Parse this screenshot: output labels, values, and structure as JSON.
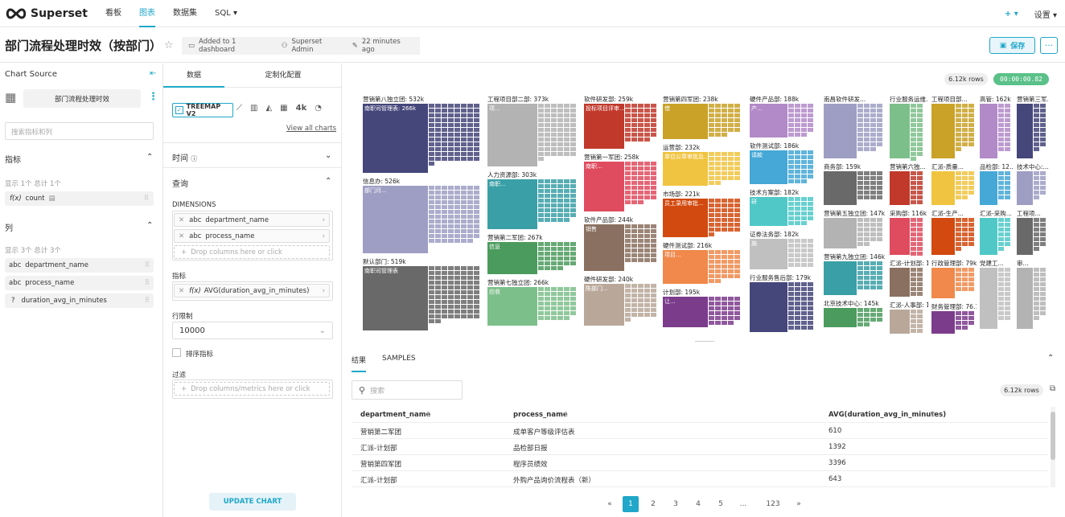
{
  "nav": {
    "brand": "Superset",
    "links": [
      "看板",
      "图表",
      "数据集",
      "SQL ▾"
    ],
    "plus": "+ ▾",
    "settings": "设置 ▾"
  },
  "header": {
    "title": "部门流程处理时效（按部门）",
    "dashboards": "Added to 1 dashboard",
    "owner": "Superset Admin",
    "modified": "22 minutes ago",
    "save": "保存"
  },
  "source": {
    "label": "Chart Source",
    "dataset": "部门流程处理时效",
    "search_placeholder": "搜索指标和列",
    "metrics_title": "指标",
    "metrics_count": "显示 1个 总计 1个",
    "metrics": [
      "count"
    ],
    "columns_title": "列",
    "columns_count": "显示 3个 总计 3个",
    "columns": [
      {
        "type": "abc",
        "name": "department_name"
      },
      {
        "type": "abc",
        "name": "process_name"
      },
      {
        "type": "?",
        "name": "duration_avg_in_minutes"
      }
    ]
  },
  "config": {
    "tab_data": "数据",
    "tab_custom": "定制化配置",
    "viz_name": "TREEMAP V2",
    "viz_4k": "4k",
    "view_all": "View all charts",
    "time": "时间",
    "query": "查询",
    "dimensions_label": "DIMENSIONS",
    "dimensions": [
      "department_name",
      "process_name"
    ],
    "dim_drop": "Drop columns here or click",
    "metrics_label": "指标",
    "metric": "AVG(duration_avg_in_minutes)",
    "row_limit_label": "行限制",
    "row_limit": "10000",
    "sort_label": "排序指标",
    "filter_label": "过滤",
    "filter_drop": "Drop columns/metrics here or click",
    "update": "UPDATE CHART"
  },
  "chart": {
    "rows_badge": "6.12k rows",
    "timer": "00:00:00.82",
    "colors": [
      "#45467a",
      "#9e9ec4",
      "#696969",
      "#b3b3b3",
      "#3a9fa6",
      "#4c9b5e",
      "#7dbf8a",
      "#c0392b",
      "#e04c5f",
      "#8a7060",
      "#b9a89a",
      "#c9a227",
      "#f0c440",
      "#d24a0f",
      "#f0894b",
      "#7c3c8c",
      "#b28ac8",
      "#45a8d6",
      "#50c8c8",
      "#c0c0c0"
    ]
  },
  "chart_data": {
    "type": "treemap",
    "groups": [
      {
        "name": "营销第八独立团: 532k",
        "value": 532
      },
      {
        "name": "工程项目部二部: 373k",
        "value": 373
      },
      {
        "name": "软件研发部: 259k",
        "value": 259
      },
      {
        "name": "营销第四军团: 238k",
        "value": 238
      },
      {
        "name": "硬件产品部: 188k",
        "value": 188
      },
      {
        "name": "南昌软件研发...",
        "value": 170
      },
      {
        "name": "行业服务运维...",
        "value": 170
      },
      {
        "name": "工程项目部...",
        "value": 165
      },
      {
        "name": "高管: 162k",
        "value": 162
      },
      {
        "name": "营销第三军...",
        "value": 160
      },
      {
        "name": "信息办: 526k",
        "value": 526
      },
      {
        "name": "人力资源部: 303k",
        "value": 303
      },
      {
        "name": "营销第一军团: 258k",
        "value": 258
      },
      {
        "name": "运营部: 232k",
        "value": 232
      },
      {
        "name": "软件测试部: 186k",
        "value": 186
      },
      {
        "name": "商务部: 159k",
        "value": 159
      },
      {
        "name": "营销第六独...",
        "value": 155
      },
      {
        "name": "汇派-质量...",
        "value": 150
      },
      {
        "name": "品检部: 12...",
        "value": 125
      },
      {
        "name": "技术中心:...",
        "value": 120
      },
      {
        "name": "市场部: 221k",
        "value": 221
      },
      {
        "name": "技术方案部: 182k",
        "value": 182
      },
      {
        "name": "营销第五独立团: 147k",
        "value": 147
      },
      {
        "name": "软件产品部: 244k",
        "value": 244
      },
      {
        "name": "营销第二军团: 267k",
        "value": 267
      },
      {
        "name": "采购部: 116k",
        "value": 116
      },
      {
        "name": "汇派-生产...",
        "value": 110
      },
      {
        "name": "汇派-采购...",
        "value": 108
      },
      {
        "name": "工程项...",
        "value": 105
      },
      {
        "name": "默认部门: 519k",
        "value": 519
      },
      {
        "name": "硬件测试部: 216k",
        "value": 216
      },
      {
        "name": "证券法务部: 182k",
        "value": 182
      },
      {
        "name": "营销第九独立团: 146k",
        "value": 146
      },
      {
        "name": "汇派-计划部: 115k",
        "value": 115
      },
      {
        "name": "营销第七独立团: 266k",
        "value": 266
      },
      {
        "name": "硬件研发部: 240k",
        "value": 240
      },
      {
        "name": "计划部: 195k",
        "value": 195
      },
      {
        "name": "行业服务售后部: 179k",
        "value": 179
      },
      {
        "name": "北京技术中心: 145k",
        "value": 145
      },
      {
        "name": "汇派-人事部: 113k",
        "value": 113
      },
      {
        "name": "行政管理部: 79k",
        "value": 79
      },
      {
        "name": "党建工...",
        "value": 75
      },
      {
        "name": "审...",
        "value": 70
      },
      {
        "name": "财务管理部: 76.1k",
        "value": 76.1
      }
    ],
    "inner_labels": [
      "南职司管理表: 266k",
      "部门月...",
      "南职司管理表",
      "项...",
      "南职...",
      "信息",
      "应收",
      "投标项目评审...",
      "南职...",
      "销售",
      "陈部门...",
      "借",
      "单位公章审批及...",
      "员工录用审批...",
      "项目...",
      "让...",
      "产...",
      "请款",
      "研",
      "施"
    ]
  },
  "results": {
    "tab_results": "结果",
    "tab_samples": "SAMPLES",
    "search_placeholder": "搜索",
    "rows_badge": "6.12k rows",
    "columns": [
      "department_name",
      "process_name",
      "AVG(duration_avg_in_minutes)"
    ],
    "rows": [
      [
        "营销第二军团",
        "成单客户等级评估表",
        "610"
      ],
      [
        "汇派-计划部",
        "品检部日报",
        "1392"
      ],
      [
        "营销第四军团",
        "程序员绩效",
        "3396"
      ],
      [
        "汇派-计划部",
        "外购产品询价流程表（新）",
        "643"
      ]
    ],
    "pages": [
      "«",
      "1",
      "2",
      "3",
      "4",
      "5",
      "...",
      "123",
      "»"
    ]
  }
}
